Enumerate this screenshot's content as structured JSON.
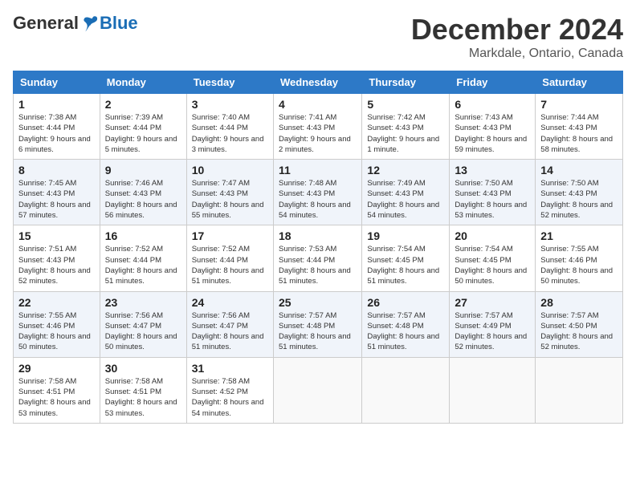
{
  "header": {
    "logo": {
      "general": "General",
      "blue": "Blue"
    },
    "title": "December 2024",
    "location": "Markdale, Ontario, Canada"
  },
  "days_of_week": [
    "Sunday",
    "Monday",
    "Tuesday",
    "Wednesday",
    "Thursday",
    "Friday",
    "Saturday"
  ],
  "weeks": [
    [
      {
        "day": "1",
        "sunrise": "7:38 AM",
        "sunset": "4:44 PM",
        "daylight": "9 hours and 6 minutes."
      },
      {
        "day": "2",
        "sunrise": "7:39 AM",
        "sunset": "4:44 PM",
        "daylight": "9 hours and 5 minutes."
      },
      {
        "day": "3",
        "sunrise": "7:40 AM",
        "sunset": "4:44 PM",
        "daylight": "9 hours and 3 minutes."
      },
      {
        "day": "4",
        "sunrise": "7:41 AM",
        "sunset": "4:43 PM",
        "daylight": "9 hours and 2 minutes."
      },
      {
        "day": "5",
        "sunrise": "7:42 AM",
        "sunset": "4:43 PM",
        "daylight": "9 hours and 1 minute."
      },
      {
        "day": "6",
        "sunrise": "7:43 AM",
        "sunset": "4:43 PM",
        "daylight": "8 hours and 59 minutes."
      },
      {
        "day": "7",
        "sunrise": "7:44 AM",
        "sunset": "4:43 PM",
        "daylight": "8 hours and 58 minutes."
      }
    ],
    [
      {
        "day": "8",
        "sunrise": "7:45 AM",
        "sunset": "4:43 PM",
        "daylight": "8 hours and 57 minutes."
      },
      {
        "day": "9",
        "sunrise": "7:46 AM",
        "sunset": "4:43 PM",
        "daylight": "8 hours and 56 minutes."
      },
      {
        "day": "10",
        "sunrise": "7:47 AM",
        "sunset": "4:43 PM",
        "daylight": "8 hours and 55 minutes."
      },
      {
        "day": "11",
        "sunrise": "7:48 AM",
        "sunset": "4:43 PM",
        "daylight": "8 hours and 54 minutes."
      },
      {
        "day": "12",
        "sunrise": "7:49 AM",
        "sunset": "4:43 PM",
        "daylight": "8 hours and 54 minutes."
      },
      {
        "day": "13",
        "sunrise": "7:50 AM",
        "sunset": "4:43 PM",
        "daylight": "8 hours and 53 minutes."
      },
      {
        "day": "14",
        "sunrise": "7:50 AM",
        "sunset": "4:43 PM",
        "daylight": "8 hours and 52 minutes."
      }
    ],
    [
      {
        "day": "15",
        "sunrise": "7:51 AM",
        "sunset": "4:43 PM",
        "daylight": "8 hours and 52 minutes."
      },
      {
        "day": "16",
        "sunrise": "7:52 AM",
        "sunset": "4:44 PM",
        "daylight": "8 hours and 51 minutes."
      },
      {
        "day": "17",
        "sunrise": "7:52 AM",
        "sunset": "4:44 PM",
        "daylight": "8 hours and 51 minutes."
      },
      {
        "day": "18",
        "sunrise": "7:53 AM",
        "sunset": "4:44 PM",
        "daylight": "8 hours and 51 minutes."
      },
      {
        "day": "19",
        "sunrise": "7:54 AM",
        "sunset": "4:45 PM",
        "daylight": "8 hours and 51 minutes."
      },
      {
        "day": "20",
        "sunrise": "7:54 AM",
        "sunset": "4:45 PM",
        "daylight": "8 hours and 50 minutes."
      },
      {
        "day": "21",
        "sunrise": "7:55 AM",
        "sunset": "4:46 PM",
        "daylight": "8 hours and 50 minutes."
      }
    ],
    [
      {
        "day": "22",
        "sunrise": "7:55 AM",
        "sunset": "4:46 PM",
        "daylight": "8 hours and 50 minutes."
      },
      {
        "day": "23",
        "sunrise": "7:56 AM",
        "sunset": "4:47 PM",
        "daylight": "8 hours and 50 minutes."
      },
      {
        "day": "24",
        "sunrise": "7:56 AM",
        "sunset": "4:47 PM",
        "daylight": "8 hours and 51 minutes."
      },
      {
        "day": "25",
        "sunrise": "7:57 AM",
        "sunset": "4:48 PM",
        "daylight": "8 hours and 51 minutes."
      },
      {
        "day": "26",
        "sunrise": "7:57 AM",
        "sunset": "4:48 PM",
        "daylight": "8 hours and 51 minutes."
      },
      {
        "day": "27",
        "sunrise": "7:57 AM",
        "sunset": "4:49 PM",
        "daylight": "8 hours and 52 minutes."
      },
      {
        "day": "28",
        "sunrise": "7:57 AM",
        "sunset": "4:50 PM",
        "daylight": "8 hours and 52 minutes."
      }
    ],
    [
      {
        "day": "29",
        "sunrise": "7:58 AM",
        "sunset": "4:51 PM",
        "daylight": "8 hours and 53 minutes."
      },
      {
        "day": "30",
        "sunrise": "7:58 AM",
        "sunset": "4:51 PM",
        "daylight": "8 hours and 53 minutes."
      },
      {
        "day": "31",
        "sunrise": "7:58 AM",
        "sunset": "4:52 PM",
        "daylight": "8 hours and 54 minutes."
      },
      null,
      null,
      null,
      null
    ]
  ]
}
